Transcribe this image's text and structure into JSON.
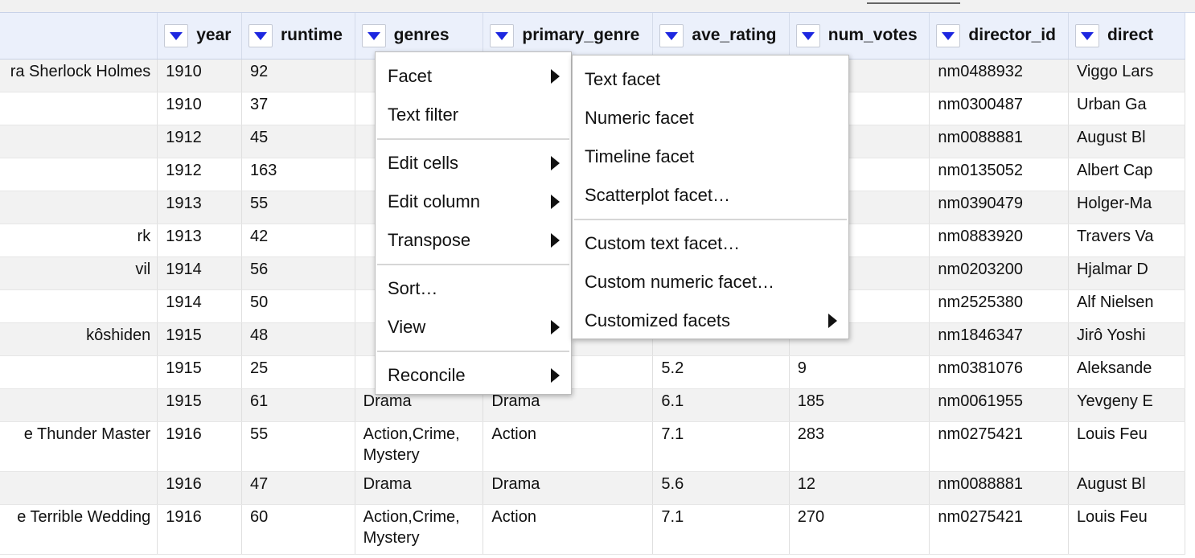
{
  "columns": [
    {
      "label": "",
      "has_dropdown": false
    },
    {
      "label": "year",
      "has_dropdown": true
    },
    {
      "label": "runtime",
      "has_dropdown": true
    },
    {
      "label": "genres",
      "has_dropdown": true
    },
    {
      "label": "primary_genre",
      "has_dropdown": true
    },
    {
      "label": "ave_rating",
      "has_dropdown": true
    },
    {
      "label": "num_votes",
      "has_dropdown": true
    },
    {
      "label": "director_id",
      "has_dropdown": true
    },
    {
      "label": "direct",
      "has_dropdown": true
    }
  ],
  "rows": [
    [
      "ra Sherlock Holmes",
      "1910",
      "92",
      "",
      "",
      "",
      "",
      "nm0488932",
      "Viggo Lars"
    ],
    [
      "",
      "1910",
      "37",
      "",
      "",
      "",
      "",
      "nm0300487",
      "Urban Ga"
    ],
    [
      "",
      "1912",
      "45",
      "",
      "",
      "",
      "",
      "nm0088881",
      "August Bl"
    ],
    [
      "",
      "1912",
      "163",
      "",
      "",
      "",
      "",
      "nm0135052",
      "Albert Cap"
    ],
    [
      "",
      "1913",
      "55",
      "",
      "",
      "",
      "",
      "nm0390479",
      "Holger-Ma"
    ],
    [
      "rk",
      "1913",
      "42",
      "",
      "",
      "",
      "",
      "nm0883920",
      "Travers Va"
    ],
    [
      "vil",
      "1914",
      "56",
      "",
      "",
      "",
      "",
      "nm0203200",
      "Hjalmar D"
    ],
    [
      "",
      "1914",
      "50",
      "",
      "",
      "",
      "",
      "nm2525380",
      "Alf Nielsen"
    ],
    [
      "kôshiden",
      "1915",
      "48",
      "",
      "",
      "",
      "",
      "nm1846347",
      "Jirô Yoshi"
    ],
    [
      "",
      "1915",
      "25",
      "",
      "",
      "5.2",
      "9",
      "nm0381076",
      "Aleksande"
    ],
    [
      "",
      "1915",
      "61",
      "Drama",
      "Drama",
      "6.1",
      "185",
      "nm0061955",
      "Yevgeny E"
    ],
    [
      "e Thunder Master",
      "1916",
      "55",
      "Action,Crime, Mystery",
      "Action",
      "7.1",
      "283",
      "nm0275421",
      "Louis Feu"
    ],
    [
      "",
      "1916",
      "47",
      "Drama",
      "Drama",
      "5.6",
      "12",
      "nm0088881",
      "August Bl"
    ],
    [
      "e Terrible Wedding",
      "1916",
      "60",
      "Action,Crime, Mystery",
      "Action",
      "7.1",
      "270",
      "nm0275421",
      "Louis Feu"
    ]
  ],
  "column_menu": {
    "items": [
      {
        "label": "Facet",
        "submenu": true
      },
      {
        "label": "Text filter",
        "submenu": false
      },
      {
        "separator": true
      },
      {
        "label": "Edit cells",
        "submenu": true
      },
      {
        "label": "Edit column",
        "submenu": true
      },
      {
        "label": "Transpose",
        "submenu": true
      },
      {
        "separator": true
      },
      {
        "label": "Sort…",
        "submenu": false
      },
      {
        "label": "View",
        "submenu": true
      },
      {
        "separator": true
      },
      {
        "label": "Reconcile",
        "submenu": true
      }
    ]
  },
  "facet_submenu": {
    "items": [
      {
        "label": "Text facet",
        "submenu": false
      },
      {
        "label": "Numeric facet",
        "submenu": false
      },
      {
        "label": "Timeline facet",
        "submenu": false
      },
      {
        "label": "Scatterplot facet…",
        "submenu": false
      },
      {
        "separator": true
      },
      {
        "label": "Custom text facet…",
        "submenu": false
      },
      {
        "label": "Custom numeric facet…",
        "submenu": false
      },
      {
        "label": "Customized facets",
        "submenu": true
      }
    ]
  },
  "icons": {
    "column_dropdown": "triangle-down-icon",
    "submenu_arrow": "triangle-right-icon"
  },
  "colors": {
    "header_bg": "#ebf0fb",
    "dropdown_arrow": "#1d27e0",
    "row_alt": "#f2f2f2"
  }
}
